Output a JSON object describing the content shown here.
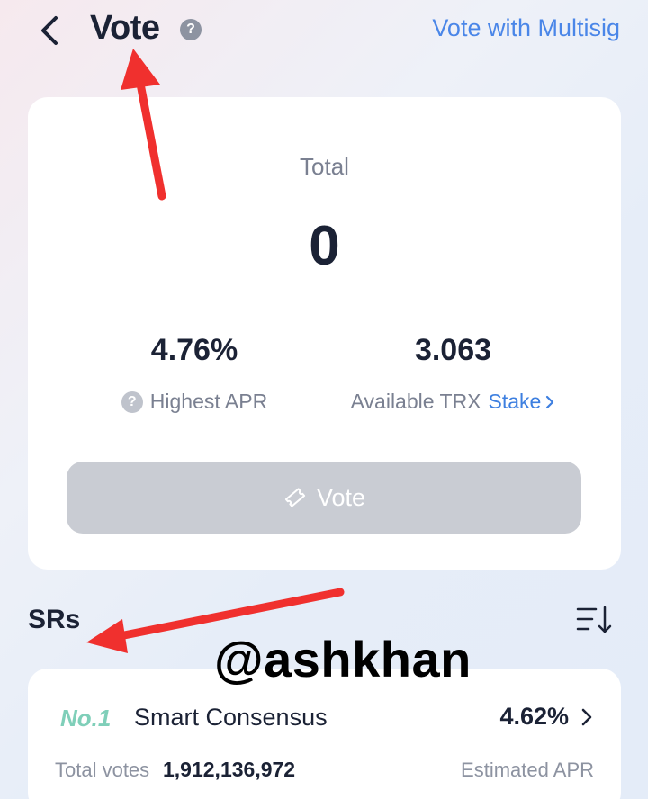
{
  "header": {
    "title": "Vote",
    "help_icon": "question-circle-icon",
    "multisig_label": "Vote with Multisig"
  },
  "summary": {
    "total_label": "Total",
    "total_value": "0",
    "highest_apr_value": "4.76%",
    "highest_apr_label": "Highest APR",
    "available_trx_value": "3.063",
    "available_trx_label": "Available TRX",
    "stake_label": "Stake",
    "vote_button_label": "Vote"
  },
  "srs": {
    "title": "SRs",
    "sort_icon": "sort-icon",
    "items": [
      {
        "rank": "No.1",
        "name": "Smart Consensus",
        "apr": "4.62%",
        "total_votes_label": "Total votes",
        "total_votes": "1,912,136,972",
        "estimated_apr_label": "Estimated APR"
      }
    ]
  },
  "overlay": {
    "watermark": "@ashkhan",
    "annotation_color": "#f0302e"
  },
  "colors": {
    "accent_blue": "#4a86e8",
    "rank_green": "#7fcfb9",
    "disabled_button": "#c9ccd3"
  }
}
